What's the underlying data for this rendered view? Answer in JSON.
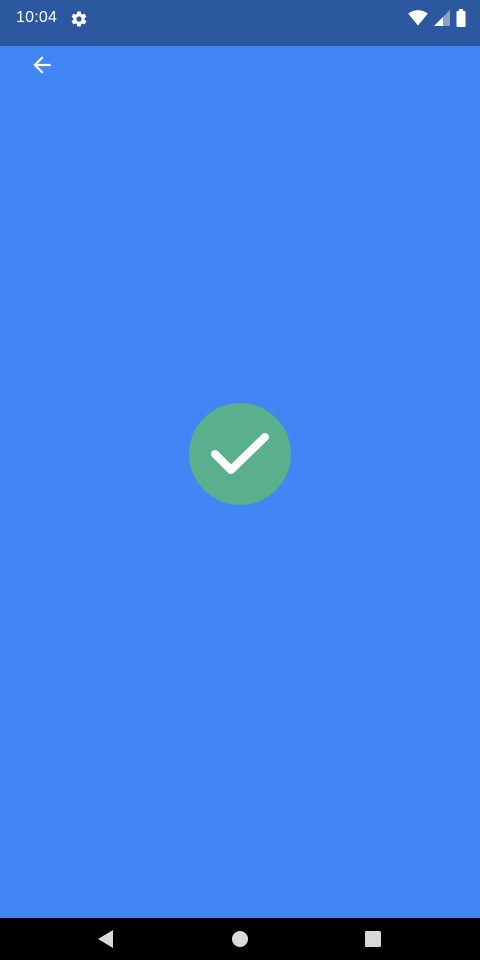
{
  "status_bar": {
    "time": "10:04",
    "icons": [
      "settings-gear-icon",
      "wifi-icon",
      "cell-signal-icon",
      "battery-icon"
    ]
  },
  "toolbar": {
    "back_icon": "arrow-back-icon"
  },
  "main": {
    "status_icon": "checkmark-icon"
  },
  "nav_bar": {
    "icons": [
      "nav-back-icon",
      "nav-home-icon",
      "nav-recents-icon"
    ]
  },
  "colors": {
    "background": "#4286f5",
    "status_bar": "#2c58a0",
    "success": "#5aaf8c",
    "nav_bar": "#000000",
    "foreground": "#ffffff"
  }
}
